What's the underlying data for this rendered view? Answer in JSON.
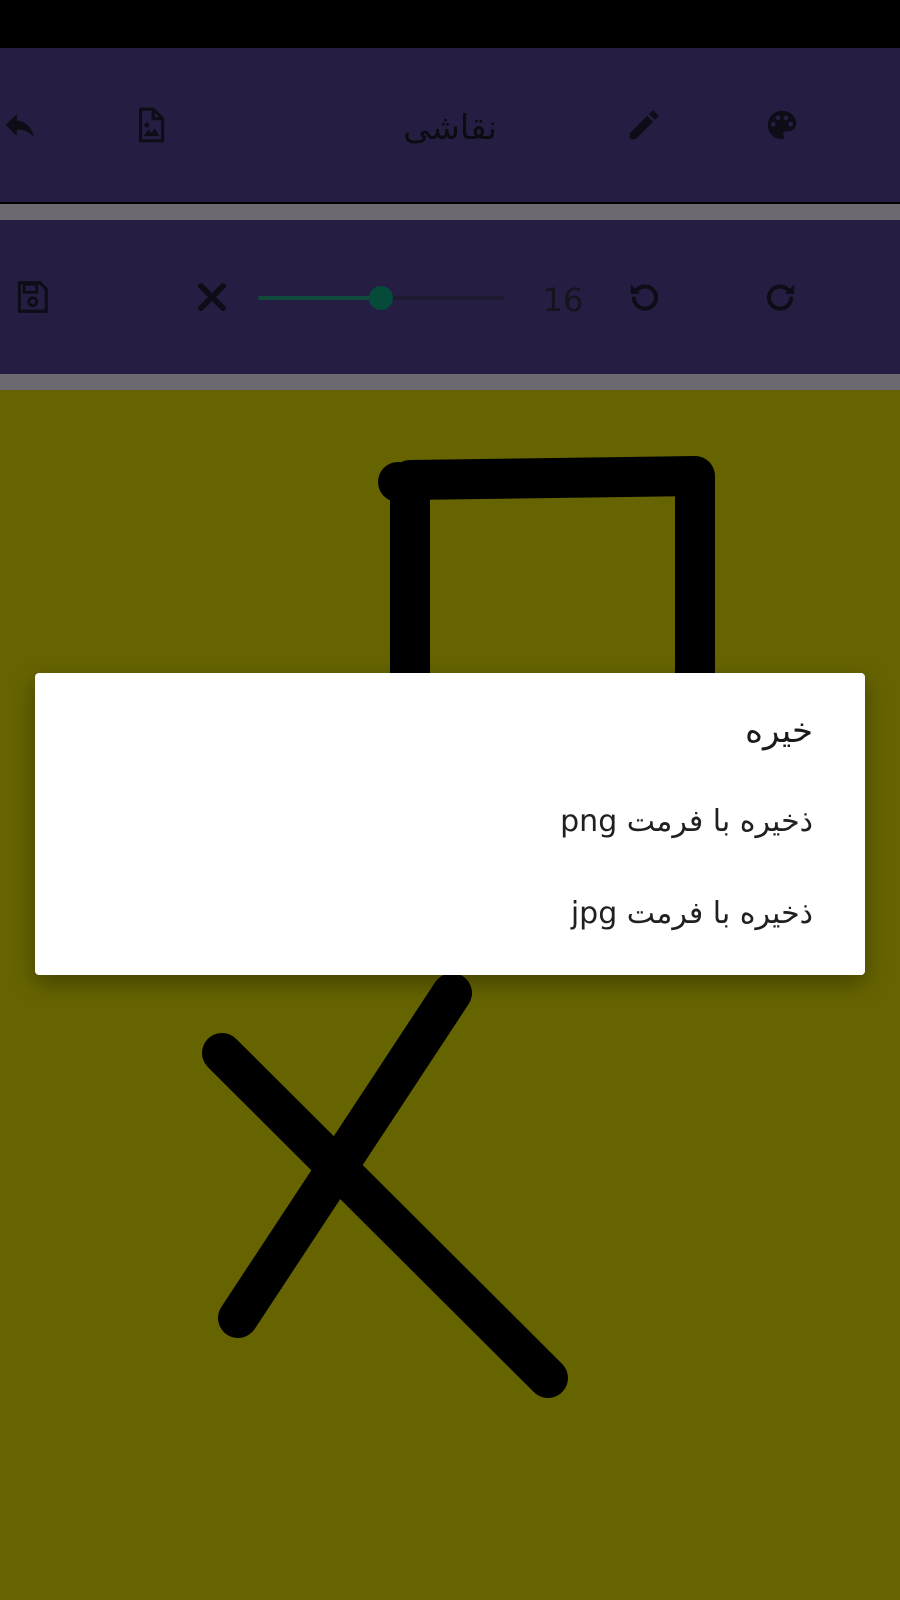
{
  "app": {
    "title": "نقاشی"
  },
  "toolbar_top": {
    "icons": [
      "undo-arrow-icon",
      "image-file-icon",
      "pencil-icon",
      "palette-icon"
    ]
  },
  "toolbar_bottom": {
    "icons": [
      "save-icon",
      "close-icon",
      "rotate-left-icon",
      "rotate-right-icon"
    ],
    "brush_size": "16",
    "slider_fraction": 0.5
  },
  "dialog": {
    "title": "خیره",
    "options": [
      {
        "label": "ذخیره با فرمت png"
      },
      {
        "label": "ذخیره با فرمت jpg"
      }
    ]
  },
  "colors": {
    "toolbar_bg": "#261e42",
    "canvas_bg": "#666400",
    "slider_accent": "#064a3a",
    "stroke": "#000000"
  }
}
